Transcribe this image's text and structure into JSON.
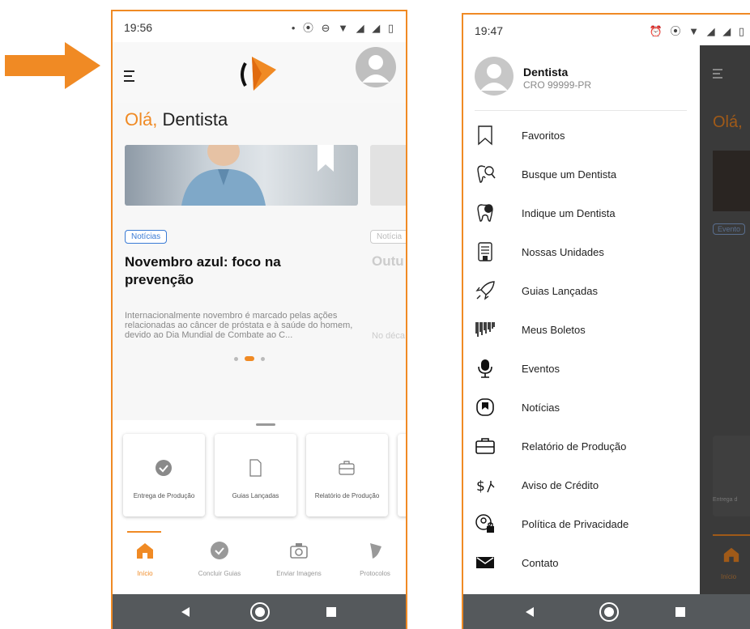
{
  "colors": {
    "accent": "#f08a24",
    "link": "#3a7bd5",
    "navbar": "#55595c"
  },
  "phone1": {
    "status": {
      "time": "19:56",
      "icons": "• ⦿ ⊖ ▼ ◢ ◢ ▯"
    },
    "greeting": {
      "hi": "Olá,",
      "name": " Dentista"
    },
    "news": {
      "tag": "Notícias",
      "title": "Novembro azul: foco na prevenção",
      "description": "Internacionalmente novembro é marcado pelas ações relacionadas ao câncer de próstata e à saúde do homem, devido ao Dia Mundial de Combate ao C...",
      "next_tag": "Notícia",
      "next_title": "Outu",
      "next_desc": "No déca"
    },
    "quick_actions": [
      "Entrega de Produção",
      "Guias Lançadas",
      "Relatório de Produção"
    ],
    "tabs": [
      {
        "label": "Início",
        "icon": "home-icon",
        "active": true
      },
      {
        "label": "Concluir Guias",
        "icon": "check-circle-icon",
        "active": false
      },
      {
        "label": "Enviar Imagens",
        "icon": "camera-icon",
        "active": false
      },
      {
        "label": "Protocolos",
        "icon": "shield-icon",
        "active": false
      }
    ]
  },
  "phone2": {
    "status": {
      "time": "19:47",
      "icons": "⏰ ⦿ ▼ ◢ ◢ ▯"
    },
    "profile": {
      "name": "Dentista",
      "cro": "CRO 99999-PR"
    },
    "menu": [
      {
        "label": "Favoritos",
        "icon": "bookmark-icon"
      },
      {
        "label": "Busque um Dentista",
        "icon": "tooth-search-icon"
      },
      {
        "label": "Indique um Dentista",
        "icon": "tooth-share-icon"
      },
      {
        "label": "Nossas Unidades",
        "icon": "building-icon"
      },
      {
        "label": "Guias Lançadas",
        "icon": "rocket-icon"
      },
      {
        "label": "Meus Boletos",
        "icon": "barcode-icon"
      },
      {
        "label": "Eventos",
        "icon": "microphone-icon"
      },
      {
        "label": "Notícias",
        "icon": "news-icon"
      },
      {
        "label": "Relatório de Produção",
        "icon": "briefcase-icon"
      },
      {
        "label": "Aviso de Crédito",
        "icon": "money-icon"
      },
      {
        "label": "Política de Privacidade",
        "icon": "user-lock-icon"
      },
      {
        "label": "Contato",
        "icon": "envelope-icon"
      }
    ],
    "background": {
      "greeting": "Olá,",
      "tag": "Evento",
      "tab_label": "Início",
      "card_label": "Entrega d"
    }
  }
}
